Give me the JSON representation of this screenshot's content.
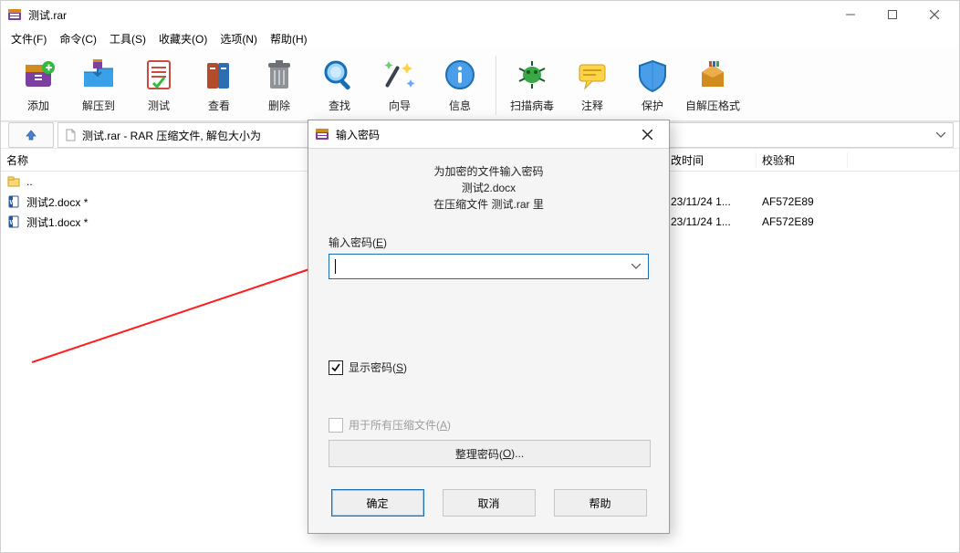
{
  "title": "测试.rar",
  "menus": [
    "文件(F)",
    "命令(C)",
    "工具(S)",
    "收藏夹(O)",
    "选项(N)",
    "帮助(H)"
  ],
  "toolbar": [
    {
      "id": "add",
      "label": "添加"
    },
    {
      "id": "extract",
      "label": "解压到"
    },
    {
      "id": "test",
      "label": "测试"
    },
    {
      "id": "view",
      "label": "查看"
    },
    {
      "id": "delete",
      "label": "删除"
    },
    {
      "id": "find",
      "label": "查找"
    },
    {
      "id": "wizard",
      "label": "向导"
    },
    {
      "id": "info",
      "label": "信息"
    },
    {
      "id": "virus",
      "label": "扫描病毒"
    },
    {
      "id": "comment",
      "label": "注释"
    },
    {
      "id": "protect",
      "label": "保护"
    },
    {
      "id": "sfx",
      "label": "自解压格式"
    }
  ],
  "address": "测试.rar - RAR 压缩文件, 解包大小为",
  "columns": {
    "name": "名称",
    "mtime": "改时间",
    "crc": "校验和"
  },
  "rows": [
    {
      "type": "up",
      "name": "..",
      "mtime": "",
      "crc": ""
    },
    {
      "type": "docx",
      "name": "测试2.docx *",
      "mtime": "23/11/24 1...",
      "crc": "AF572E89"
    },
    {
      "type": "docx",
      "name": "测试1.docx *",
      "mtime": "23/11/24 1...",
      "crc": "AF572E89"
    }
  ],
  "dialog": {
    "title": "输入密码",
    "prompt": "为加密的文件输入密码",
    "file": "测试2.docx",
    "location": "在压缩文件 测试.rar 里",
    "password_label_pre": "输入密码(",
    "password_label_u": "E",
    "password_label_post": ")",
    "password_value": "",
    "show_label_pre": "显示密码(",
    "show_label_u": "S",
    "show_label_post": ")",
    "show_checked": true,
    "all_label_pre": "用于所有压缩文件(",
    "all_label_u": "A",
    "all_label_post": ")",
    "all_checked": false,
    "all_enabled": false,
    "organize_pre": "整理密码(",
    "organize_u": "O",
    "organize_post": ")...",
    "ok": "确定",
    "cancel": "取消",
    "help": "帮助"
  }
}
